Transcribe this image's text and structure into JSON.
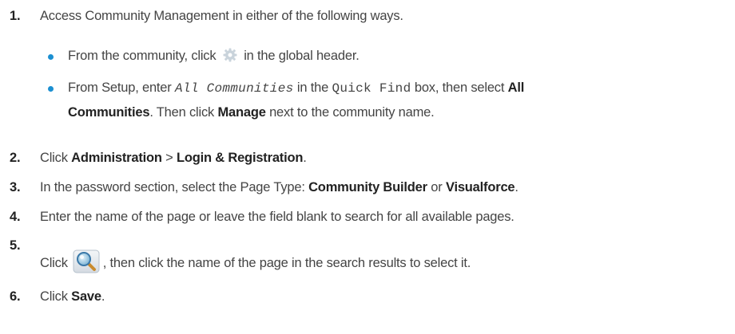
{
  "steps": [
    {
      "num": "1.",
      "text": "Access Community Management in either of the following ways.",
      "bullets": [
        {
          "before": "From the community, click",
          "after": "in the global header."
        },
        {
          "p1": "From Setup, enter",
          "code1": "All Communities",
          "p2": "in the",
          "code2": "Quick Find",
          "p3": "box, then select",
          "b1a": "All",
          "b1b": "Communities",
          "p4": ". Then click",
          "b2": "Manage",
          "p5": "next to the community name."
        }
      ]
    },
    {
      "num": "2.",
      "p1": "Click",
      "b1": "Administration",
      "p2": ">",
      "b2": "Login & Registration",
      "p3": "."
    },
    {
      "num": "3.",
      "p1": "In the password section, select the Page Type:",
      "b1": "Community Builder",
      "p2": "or",
      "b2": "Visualforce",
      "p3": "."
    },
    {
      "num": "4.",
      "text": "Enter the name of the page or leave the field blank to search for all available pages."
    },
    {
      "num": "5.",
      "p1": "Click",
      "p2": ", then click the name of the page in the search results to select it."
    },
    {
      "num": "6.",
      "p1": "Click",
      "b1": "Save",
      "p2": "."
    }
  ],
  "colors": {
    "text": "#444444",
    "bold": "#222222",
    "bullet": "#1b8fd1"
  },
  "icons": {
    "gear": "gear-icon",
    "lookup": "search-lookup-icon"
  }
}
